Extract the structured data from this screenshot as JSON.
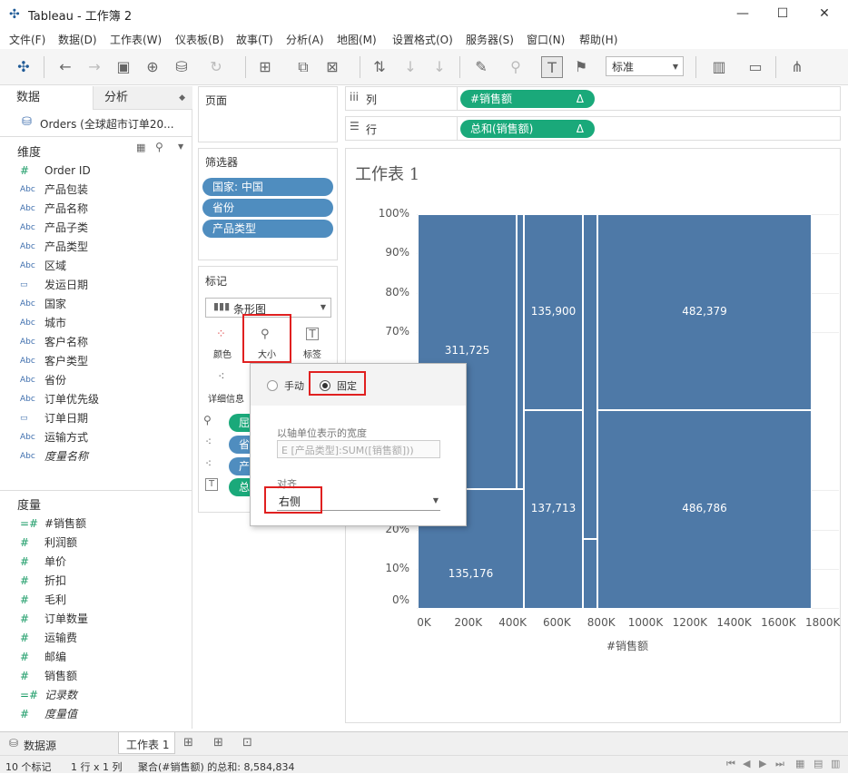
{
  "window": {
    "title": "Tableau - 工作簿 2"
  },
  "menu": [
    "文件(F)",
    "数据(D)",
    "工作表(W)",
    "仪表板(B)",
    "故事(T)",
    "分析(A)",
    "地图(M)",
    "设置格式(O)",
    "服务器(S)",
    "窗口(N)",
    "帮助(H)"
  ],
  "toolbar": {
    "fit_select": "标准"
  },
  "left": {
    "tab_data": "数据",
    "tab_analysis": "分析",
    "datasource": "Orders (全球超市订单20...",
    "dimensions_title": "维度",
    "dimensions": [
      {
        "type": "#",
        "name": "Order ID"
      },
      {
        "type": "Abc",
        "name": "产品包装"
      },
      {
        "type": "Abc",
        "name": "产品名称"
      },
      {
        "type": "Abc",
        "name": "产品子类"
      },
      {
        "type": "Abc",
        "name": "产品类型"
      },
      {
        "type": "Abc",
        "name": "区域"
      },
      {
        "type": "日",
        "name": "发运日期"
      },
      {
        "type": "Abc",
        "name": "国家"
      },
      {
        "type": "Abc",
        "name": "城市"
      },
      {
        "type": "Abc",
        "name": "客户名称"
      },
      {
        "type": "Abc",
        "name": "客户类型"
      },
      {
        "type": "Abc",
        "name": "省份"
      },
      {
        "type": "Abc",
        "name": "订单优先级"
      },
      {
        "type": "日",
        "name": "订单日期"
      },
      {
        "type": "Abc",
        "name": "运输方式"
      },
      {
        "type": "Abc",
        "name": "度量名称"
      }
    ],
    "measures_title": "度量",
    "measures": [
      {
        "type": "=#",
        "name": "#销售额"
      },
      {
        "type": "#",
        "name": "利润额"
      },
      {
        "type": "#",
        "name": "单价"
      },
      {
        "type": "#",
        "name": "折扣"
      },
      {
        "type": "#",
        "name": "毛利"
      },
      {
        "type": "#",
        "name": "订单数量"
      },
      {
        "type": "#",
        "name": "运输费"
      },
      {
        "type": "#",
        "name": "邮编"
      },
      {
        "type": "#",
        "name": "销售额"
      },
      {
        "type": "=#",
        "name": "记录数"
      },
      {
        "type": "#",
        "name": "度量值"
      }
    ]
  },
  "shelves": {
    "pages_title": "页面",
    "columns_label": "列",
    "rows_label": "行",
    "columns_pill": "#销售额",
    "rows_pill": "总和(销售额)",
    "delta": "Δ",
    "filters_title": "筛选器",
    "filters": [
      "国家: 中国",
      "省份",
      "产品类型"
    ]
  },
  "marks": {
    "title": "标记",
    "type": "条形图",
    "color": "颜色",
    "size": "大小",
    "label": "标签",
    "detail": "详细信息",
    "pill_1": "屈",
    "pill_2": "省",
    "pill_3": "产",
    "pill_4": "总"
  },
  "sheet": {
    "title": "工作表 1"
  },
  "chart_data": {
    "type": "bar",
    "xlabel": "#销售额",
    "x_ticks": [
      "0K",
      "200K",
      "400K",
      "600K",
      "800K",
      "1000K",
      "1200K",
      "1400K",
      "1600K",
      "1800K"
    ],
    "y_ticks": [
      "100%",
      "90%",
      "80%",
      "70%",
      "20%",
      "10%",
      "0%"
    ],
    "xlim": [
      0,
      1800000
    ],
    "ylim": [
      0,
      1
    ],
    "data_labels": [
      "311,725",
      "135,900",
      "482,379",
      "135,176",
      "137,713",
      "486,786"
    ]
  },
  "popup": {
    "manual": "手动",
    "fixed": "固定",
    "width_label": "以轴单位表示的宽度",
    "width_value": "E [产品类型]:SUM([销售额]))",
    "align_label": "对齐",
    "align_value": "右侧"
  },
  "tabs": {
    "datasource": "数据源",
    "sheet1": "工作表 1"
  },
  "status": {
    "marks": "10 个标记",
    "rowscols": "1 行 x 1 列",
    "sum": "聚合(#销售额) 的总和: 8,584,834"
  }
}
